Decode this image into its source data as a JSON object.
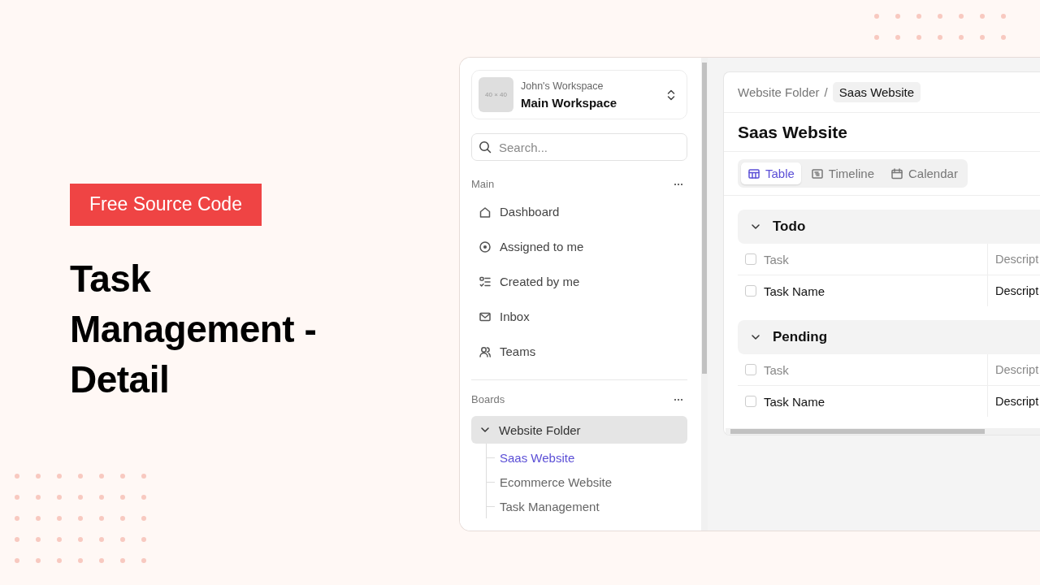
{
  "hero": {
    "badge": "Free Source Code",
    "title": "Task Management - Detail"
  },
  "sidebar": {
    "workspace": {
      "avatar_label": "40 × 40",
      "owner": "John's Workspace",
      "name": "Main Workspace"
    },
    "search": {
      "placeholder": "Search..."
    },
    "main_section": {
      "title": "Main",
      "items": [
        {
          "label": "Dashboard",
          "kind": "home"
        },
        {
          "label": "Assigned to me",
          "kind": "target"
        },
        {
          "label": "Created by me",
          "kind": "checklist"
        },
        {
          "label": "Inbox",
          "kind": "mail"
        },
        {
          "label": "Teams",
          "kind": "users"
        }
      ]
    },
    "boards_section": {
      "title": "Boards",
      "folders": [
        {
          "label": "Website Folder",
          "expanded": true,
          "children": [
            {
              "label": "Saas Website",
              "selected": true
            },
            {
              "label": "Ecommerce Website",
              "selected": false
            },
            {
              "label": "Task Management",
              "selected": false
            }
          ]
        }
      ]
    }
  },
  "main": {
    "breadcrumb": [
      "Website Folder",
      "Saas Website"
    ],
    "separator": "/",
    "title": "Saas Website",
    "tabs": [
      {
        "label": "Table",
        "kind": "table",
        "selected": true
      },
      {
        "label": "Timeline",
        "kind": "timeline",
        "selected": false
      },
      {
        "label": "Calendar",
        "kind": "calendar",
        "selected": false
      }
    ],
    "groups": [
      {
        "title": "Todo",
        "expanded": true,
        "header_checked": false,
        "columns": [
          "Task",
          "Descript"
        ],
        "rows": [
          {
            "checked": false,
            "cells": [
              "Task Name",
              "Descript"
            ]
          }
        ]
      },
      {
        "title": "Pending",
        "expanded": true,
        "header_checked": false,
        "columns": [
          "Task",
          "Descript"
        ],
        "rows": [
          {
            "checked": false,
            "cells": [
              "Task Name",
              "Descript"
            ]
          }
        ]
      }
    ]
  }
}
